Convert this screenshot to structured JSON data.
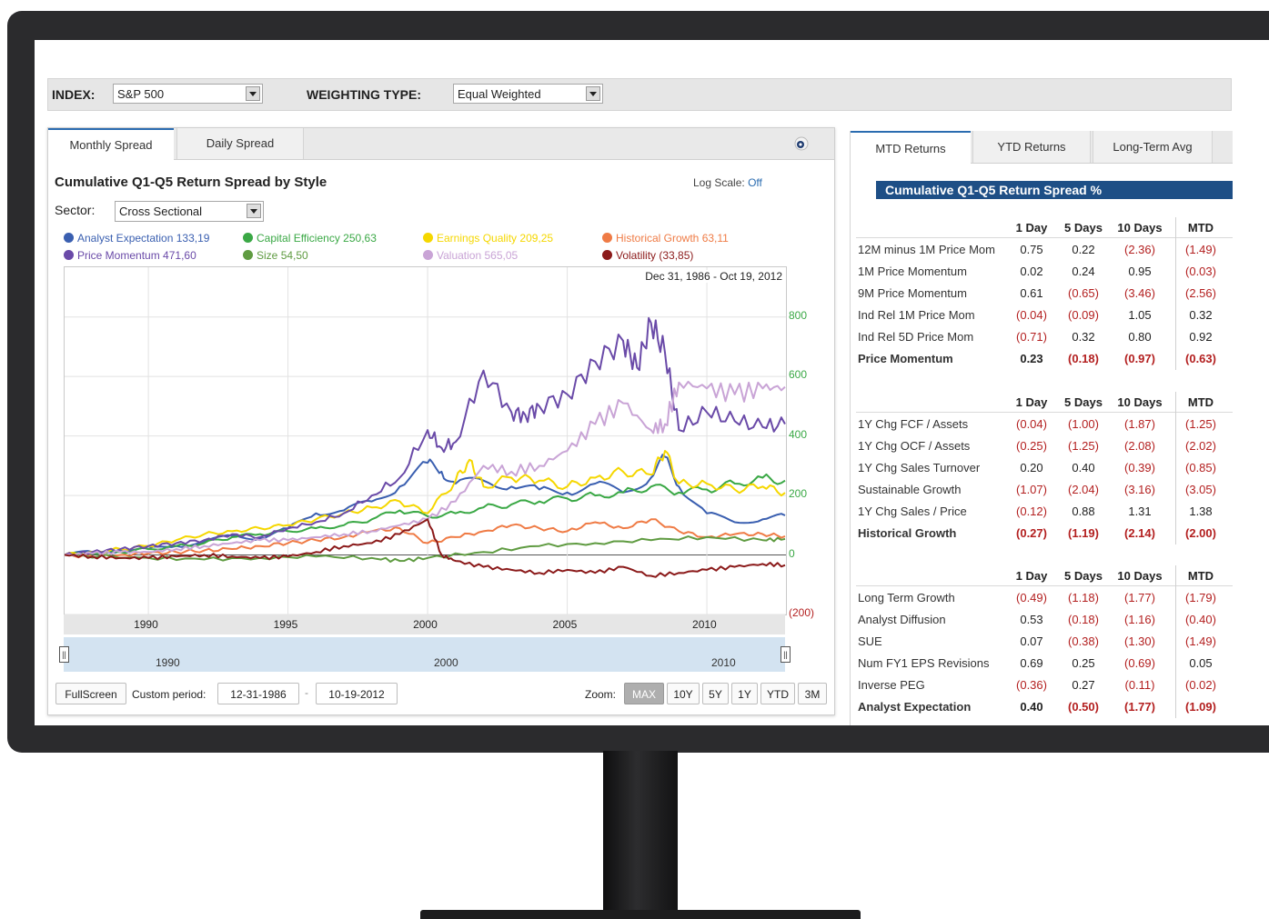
{
  "toolbar": {
    "index_label": "INDEX:",
    "index_value": "S&P 500",
    "weighting_label": "WEIGHTING TYPE:",
    "weighting_value": "Equal Weighted"
  },
  "left_panel": {
    "tabs": [
      "Monthly Spread",
      "Daily Spread"
    ],
    "active_tab": "Monthly Spread",
    "title": "Cumulative Q1-Q5 Return Spread by Style",
    "log_scale_label": "Log Scale:",
    "log_scale_value": "Off",
    "sector_label": "Sector:",
    "sector_value": "Cross Sectional",
    "date_range": "Dec 31, 1986 - Oct 19, 2012",
    "navigator_labels": [
      "1990",
      "2000",
      "2010"
    ],
    "fullscreen_label": "FullScreen",
    "custom_period_label": "Custom period:",
    "period_from": "12-31-1986",
    "period_separator": "-",
    "period_to": "10-19-2012",
    "zoom_label": "Zoom:",
    "zoom_buttons": [
      "MAX",
      "10Y",
      "5Y",
      "1Y",
      "YTD",
      "3M"
    ],
    "active_zoom": "MAX"
  },
  "chart_data": {
    "type": "line",
    "title": "Cumulative Q1-Q5 Return Spread by Style",
    "x_range": [
      1987,
      2012.8
    ],
    "ylim": [
      -200,
      900
    ],
    "y_ticks": [
      {
        "value": 800,
        "label": "800"
      },
      {
        "value": 600,
        "label": "600"
      },
      {
        "value": 400,
        "label": "400"
      },
      {
        "value": 200,
        "label": "200"
      },
      {
        "value": 0,
        "label": "0"
      },
      {
        "value": -200,
        "label": "(200)"
      }
    ],
    "x_ticks": [
      1990,
      1995,
      2000,
      2005,
      2010
    ],
    "grid": true,
    "legend_placement": "top",
    "series": [
      {
        "name": "Analyst Expectation",
        "legend_value": "133,19",
        "color": "#3a5fb0",
        "x": [
          1987,
          1988,
          1989,
          1990,
          1991,
          1992,
          1993,
          1994,
          1995,
          1996,
          1997,
          1998,
          1999,
          2000,
          2000.5,
          2001,
          2002,
          2003,
          2004,
          2005,
          2006,
          2007,
          2008,
          2008.5,
          2009,
          2010,
          2011,
          2012,
          2012.8
        ],
        "y": [
          0,
          10,
          15,
          20,
          30,
          45,
          65,
          55,
          90,
          140,
          150,
          180,
          230,
          310,
          280,
          240,
          250,
          230,
          220,
          210,
          240,
          210,
          260,
          330,
          230,
          140,
          110,
          120,
          133
        ]
      },
      {
        "name": "Capital Efficiency",
        "legend_value": "250,63",
        "color": "#3aa845",
        "x": [
          1987,
          1988,
          1989,
          1990,
          1991,
          1992,
          1993,
          1994,
          1995,
          1996,
          1997,
          1998,
          1999,
          2000,
          2001,
          2002,
          2003,
          2004,
          2005,
          2006,
          2007,
          2008,
          2009,
          2010,
          2011,
          2012,
          2012.8
        ],
        "y": [
          0,
          5,
          10,
          20,
          30,
          40,
          60,
          70,
          80,
          90,
          100,
          120,
          150,
          130,
          140,
          160,
          170,
          180,
          190,
          200,
          210,
          230,
          210,
          220,
          240,
          260,
          250
        ]
      },
      {
        "name": "Earnings Quality",
        "legend_value": "209,25",
        "color": "#f5d700",
        "x": [
          1987,
          1988,
          1989,
          1990,
          1991,
          1992,
          1993,
          1994,
          1995,
          1996,
          1997,
          1998,
          1999,
          2000,
          2001,
          2001.5,
          2002,
          2003,
          2004,
          2005,
          2006,
          2007,
          2008,
          2008.5,
          2009,
          2010,
          2011,
          2012,
          2012.8
        ],
        "y": [
          0,
          10,
          20,
          30,
          50,
          70,
          80,
          90,
          100,
          120,
          140,
          160,
          180,
          140,
          250,
          320,
          230,
          260,
          250,
          230,
          260,
          280,
          270,
          350,
          240,
          240,
          220,
          230,
          209
        ]
      },
      {
        "name": "Historical Growth",
        "legend_value": "63,11",
        "color": "#ef7b45",
        "x": [
          1987,
          1988,
          1989,
          1990,
          1991,
          1992,
          1993,
          1994,
          1995,
          1996,
          1997,
          1998,
          1999,
          2000,
          2001,
          2002,
          2003,
          2004,
          2005,
          2006,
          2007,
          2008,
          2009,
          2010,
          2011,
          2012,
          2012.8
        ],
        "y": [
          0,
          -5,
          0,
          5,
          10,
          15,
          20,
          30,
          40,
          50,
          60,
          80,
          90,
          40,
          60,
          80,
          100,
          90,
          80,
          110,
          90,
          120,
          80,
          60,
          70,
          70,
          63
        ]
      },
      {
        "name": "Price Momentum",
        "legend_value": "471,60",
        "color": "#6a4aa8",
        "x": [
          1987,
          1988,
          1989,
          1990,
          1991,
          1992,
          1993,
          1994,
          1995,
          1996,
          1997,
          1998,
          1999,
          2000,
          2000.5,
          2001,
          2002,
          2003,
          2003.5,
          2004,
          2005,
          2006,
          2007,
          2007.5,
          2008,
          2008.5,
          2009,
          2010,
          2011,
          2012,
          2012.8
        ],
        "y": [
          0,
          10,
          20,
          30,
          40,
          50,
          70,
          60,
          90,
          110,
          140,
          200,
          260,
          420,
          360,
          380,
          620,
          480,
          470,
          500,
          540,
          650,
          720,
          630,
          780,
          680,
          420,
          480,
          450,
          430,
          440
        ]
      },
      {
        "name": "Size",
        "legend_value": "54,50",
        "color": "#5f9b41",
        "x": [
          1987,
          1990,
          1992,
          1994,
          1996,
          1998,
          1999,
          2000,
          2002,
          2004,
          2006,
          2008,
          2010,
          2012,
          2012.8
        ],
        "y": [
          0,
          -10,
          -15,
          -10,
          -5,
          -10,
          -20,
          -10,
          10,
          30,
          40,
          50,
          60,
          50,
          54
        ]
      },
      {
        "name": "Valuation",
        "legend_value": "565,05",
        "color": "#c9a4d6",
        "x": [
          1987,
          1988,
          1989,
          1990,
          1991,
          1992,
          1993,
          1994,
          1995,
          1996,
          1997,
          1998,
          1999,
          2000,
          2001,
          2002,
          2003,
          2004,
          2005,
          2006,
          2007,
          2008,
          2008.5,
          2009,
          2010,
          2011,
          2012,
          2012.8
        ],
        "y": [
          0,
          5,
          10,
          10,
          20,
          30,
          40,
          50,
          50,
          60,
          70,
          80,
          100,
          120,
          180,
          300,
          280,
          300,
          350,
          440,
          510,
          420,
          440,
          580,
          560,
          540,
          560,
          565
        ]
      },
      {
        "name": "Volatility",
        "legend_value": "(33,85)",
        "color": "#8b1a1a",
        "x": [
          1987,
          1988,
          1989,
          1990,
          1991,
          1992,
          1993,
          1994,
          1995,
          1996,
          1997,
          1998,
          1999,
          2000,
          2000.5,
          2001,
          2002,
          2003,
          2004,
          2005,
          2006,
          2007,
          2008,
          2009,
          2010,
          2011,
          2012,
          2012.8
        ],
        "y": [
          0,
          -5,
          -10,
          -10,
          -5,
          0,
          -5,
          -10,
          -5,
          10,
          30,
          40,
          70,
          120,
          0,
          -20,
          -40,
          -50,
          -60,
          -50,
          -60,
          -40,
          -70,
          -60,
          -50,
          -40,
          -30,
          -34
        ]
      }
    ]
  },
  "right_panel": {
    "tabs": [
      "MTD Returns",
      "YTD Returns",
      "Long-Term Avg"
    ],
    "active_tab": "MTD Returns",
    "title": "Cumulative Q1-Q5 Return Spread %",
    "columns": [
      "1 Day",
      "5 Days",
      "10 Days",
      "MTD"
    ],
    "sections": [
      {
        "rows": [
          {
            "name": "12M minus 1M Price Mom",
            "values": [
              "0.75",
              "0.22",
              "(2.36)",
              "(1.49)"
            ]
          },
          {
            "name": "1M Price Momentum",
            "values": [
              "0.02",
              "0.24",
              "0.95",
              "(0.03)"
            ]
          },
          {
            "name": "9M Price Momentum",
            "values": [
              "0.61",
              "(0.65)",
              "(3.46)",
              "(2.56)"
            ]
          },
          {
            "name": "Ind Rel  1M Price Mom",
            "values": [
              "(0.04)",
              "(0.09)",
              "1.05",
              "0.32"
            ]
          },
          {
            "name": "Ind Rel  5D Price Mom",
            "values": [
              "(0.71)",
              "0.32",
              "0.80",
              "0.92"
            ]
          }
        ],
        "total": {
          "name": "Price Momentum",
          "values": [
            "0.23",
            "(0.18)",
            "(0.97)",
            "(0.63)"
          ]
        }
      },
      {
        "rows": [
          {
            "name": "1Y Chg FCF / Assets",
            "values": [
              "(0.04)",
              "(1.00)",
              "(1.87)",
              "(1.25)"
            ]
          },
          {
            "name": "1Y Chg OCF / Assets",
            "values": [
              "(0.25)",
              "(1.25)",
              "(2.08)",
              "(2.02)"
            ]
          },
          {
            "name": "1Y Chg Sales Turnover",
            "values": [
              "0.20",
              "0.40",
              "(0.39)",
              "(0.85)"
            ]
          },
          {
            "name": "Sustainable Growth",
            "values": [
              "(1.07)",
              "(2.04)",
              "(3.16)",
              "(3.05)"
            ]
          },
          {
            "name": "1Y Chg Sales / Price",
            "values": [
              "(0.12)",
              "0.88",
              "1.31",
              "1.38"
            ]
          }
        ],
        "total": {
          "name": "Historical Growth",
          "values": [
            "(0.27)",
            "(1.19)",
            "(2.14)",
            "(2.00)"
          ]
        }
      },
      {
        "rows": [
          {
            "name": "Long Term Growth",
            "values": [
              "(0.49)",
              "(1.18)",
              "(1.77)",
              "(1.79)"
            ]
          },
          {
            "name": "Analyst Diffusion",
            "values": [
              "0.53",
              "(0.18)",
              "(1.16)",
              "(0.40)"
            ]
          },
          {
            "name": "SUE",
            "values": [
              "0.07",
              "(0.38)",
              "(1.30)",
              "(1.49)"
            ]
          },
          {
            "name": "Num FY1 EPS Revisions",
            "values": [
              "0.69",
              "0.25",
              "(0.69)",
              "0.05"
            ]
          },
          {
            "name": "Inverse PEG",
            "values": [
              "(0.36)",
              "0.27",
              "(0.11)",
              "(0.02)"
            ]
          }
        ],
        "total": {
          "name": "Analyst Expectation",
          "values": [
            "0.40",
            "(0.50)",
            "(1.77)",
            "(1.09)"
          ]
        }
      }
    ]
  }
}
